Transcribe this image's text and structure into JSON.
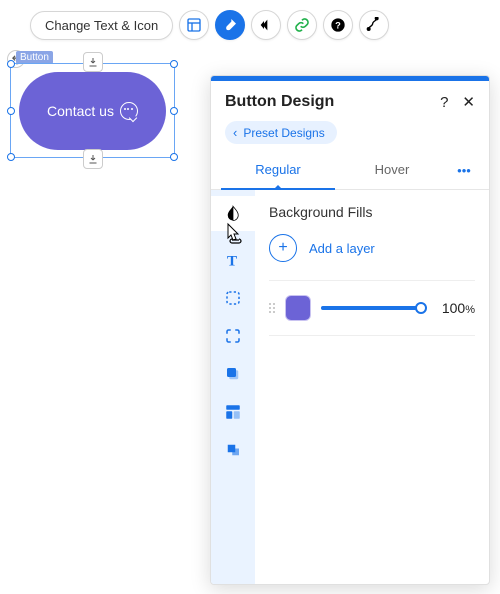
{
  "toolbar": {
    "change_label": "Change Text & Icon"
  },
  "canvas": {
    "selection_label": "Button",
    "button_text": "Contact us"
  },
  "panel": {
    "title": "Button Design",
    "breadcrumb": "Preset Designs",
    "tabs": {
      "regular": "Regular",
      "hover": "Hover"
    },
    "section_title": "Background Fills",
    "add_layer_label": "Add a layer",
    "opacity_value": "100",
    "opacity_unit": "%",
    "swatch_color": "#6c63d6"
  }
}
